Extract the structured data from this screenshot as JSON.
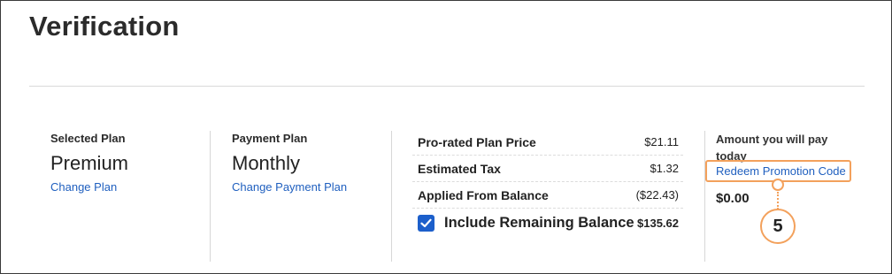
{
  "page": {
    "title": "Verification"
  },
  "plan": {
    "label": "Selected Plan",
    "value": "Premium",
    "link": "Change Plan"
  },
  "payment": {
    "label": "Payment Plan",
    "value": "Monthly",
    "link": "Change Payment Plan"
  },
  "summary": {
    "rows": [
      {
        "label": "Pro-rated Plan Price",
        "value": "$21.11"
      },
      {
        "label": "Estimated Tax",
        "value": "$1.32"
      },
      {
        "label": "Applied From Balance",
        "value": "($22.43)"
      }
    ],
    "include_balance": {
      "label": "Include Remaining Balance",
      "value": "$135.62",
      "checked": true
    }
  },
  "amount": {
    "label": "Amount you will pay today",
    "promo_link": "Redeem Promotion Code",
    "value": "$0.00"
  },
  "callout": {
    "number": "5",
    "color": "#f3a15c"
  },
  "colors": {
    "link": "#1f5fbf",
    "checkbox": "#1c5fcb"
  }
}
